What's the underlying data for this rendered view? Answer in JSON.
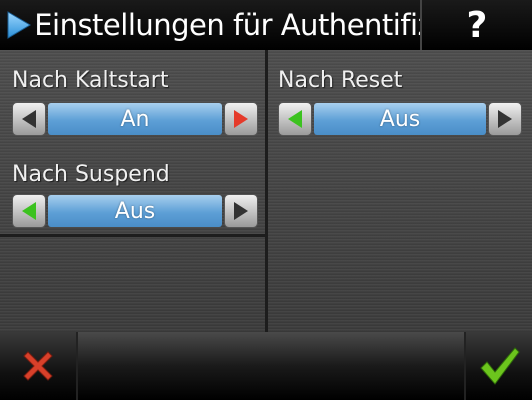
{
  "header": {
    "title": "Einstellungen für Authentifizier",
    "help_label": "?",
    "icons": {
      "title": "play-arrow-icon"
    }
  },
  "settings": [
    {
      "label": "Nach Kaltstart",
      "value": "An"
    },
    {
      "label": "Nach Reset",
      "value": "Aus"
    },
    {
      "label": "Nach Suspend",
      "value": "Aus"
    }
  ],
  "footer": {
    "cancel_icon": "close-x-icon",
    "confirm_icon": "checkmark-icon"
  },
  "colors": {
    "accent_blue": "#5d9fd6",
    "arrow_active_green": "#3cc21f",
    "arrow_active_red": "#e53a2a",
    "arrow_inactive": "#333333",
    "cancel_red": "#d8402a",
    "confirm_green": "#6cc51d"
  }
}
